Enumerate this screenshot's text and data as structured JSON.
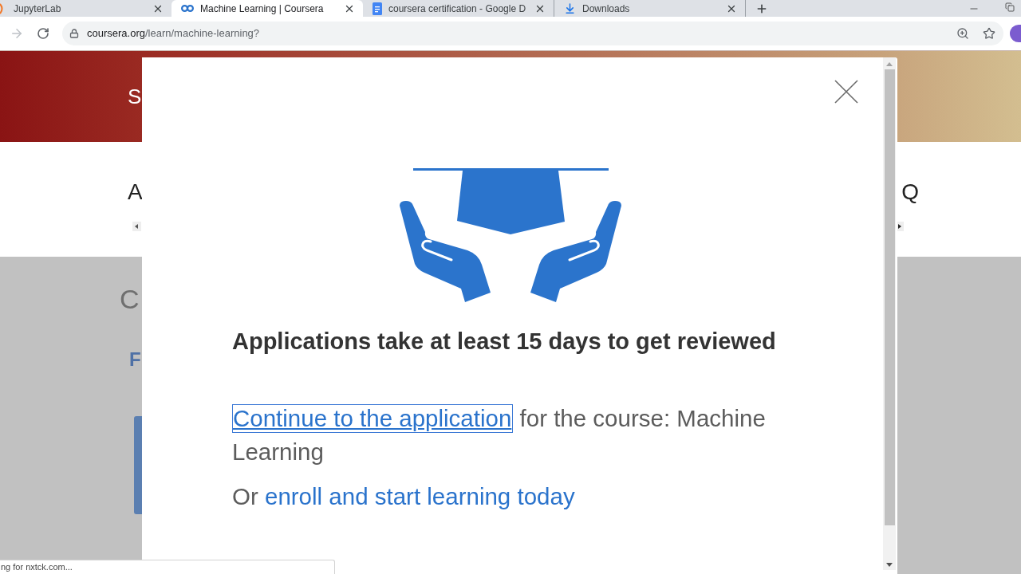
{
  "browser": {
    "tabs": [
      {
        "kind": "jupyter",
        "title": "JupyterLab",
        "selected": false
      },
      {
        "kind": "coursera",
        "title": "Machine Learning | Coursera",
        "selected": true
      },
      {
        "kind": "document",
        "title": "coursera certification - Google D",
        "selected": false
      },
      {
        "kind": "download",
        "title": "Downloads",
        "selected": false
      }
    ],
    "toolbar": {
      "forward_button": {
        "disabled": true
      },
      "address": {
        "domain": "coursera.org",
        "path": "/learn/machine-learning?"
      }
    }
  },
  "page": {
    "banner": {
      "text": "S"
    },
    "header": {
      "left_text": "A",
      "right_text": "Q"
    },
    "section": {
      "title": "C",
      "link": "F"
    }
  },
  "modal": {
    "heading": "Applications take at least 15 days to get reviewed",
    "application_link": "Continue to the application",
    "course_text": "for the course: Machine Learning",
    "or_text": "Or",
    "enroll_link": "enroll and start learning today"
  },
  "status_bubble": "ng for nxtck.com..."
}
